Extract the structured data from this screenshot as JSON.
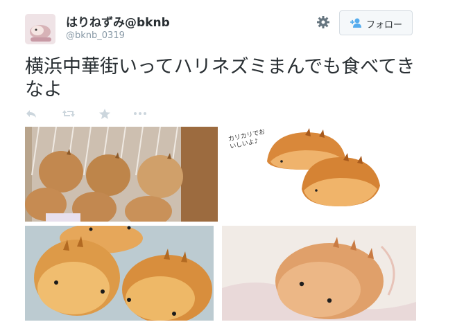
{
  "user": {
    "name": "はりねずみ@bknb",
    "handle": "@bknb_0319"
  },
  "follow_label": "フォロー",
  "tweet_text": "横浜中華街いってハリネズミまんでも食べてきなよ",
  "actions": [
    "reply-icon",
    "retweet-icon",
    "favorite-icon",
    "more-icon"
  ],
  "photos": [
    {
      "description_icon": "hedgehog-buns-in-steamer-icon"
    },
    {
      "caption": "カリカリでおいしいよ♪"
    },
    {
      "description_icon": "hedgehog-buns-pair-icon"
    },
    {
      "description_icon": "hedgehog-bun-closeup-icon"
    }
  ]
}
